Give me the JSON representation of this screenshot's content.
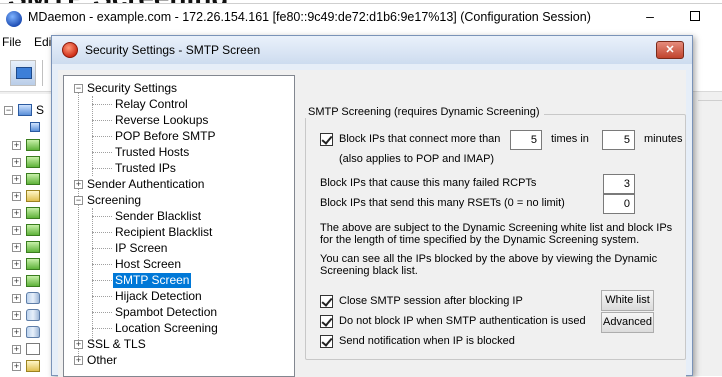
{
  "background_heading": "SMTP Screening",
  "main_window": {
    "title": "MDaemon - example.com - 172.26.154.161 [fe80::9c49:de72:d1b6:9e17%13] (Configuration Session)",
    "menu": [
      "File",
      "Edi"
    ],
    "minimize_glyph": "–",
    "tree_label": "S"
  },
  "dialog": {
    "title": "Security Settings - SMTP Screen",
    "close_glyph": "✕"
  },
  "tree": {
    "security_settings": "Security Settings",
    "relay_control": "Relay Control",
    "reverse_lookups": "Reverse Lookups",
    "pop_before_smtp": "POP Before SMTP",
    "trusted_hosts": "Trusted Hosts",
    "trusted_ips": "Trusted IPs",
    "sender_authentication": "Sender Authentication",
    "screening": "Screening",
    "sender_blacklist": "Sender Blacklist",
    "recipient_blacklist": "Recipient Blacklist",
    "ip_screen": "IP Screen",
    "host_screen": "Host Screen",
    "smtp_screen": "SMTP Screen",
    "hijack_detection": "Hijack Detection",
    "spambot_detection": "Spambot Detection",
    "location_screening": "Location Screening",
    "ssl_tls": "SSL & TLS",
    "other": "Other",
    "expand_glyph": "+",
    "collapse_glyph": "−"
  },
  "panel": {
    "group_title": "SMTP Screening (requires Dynamic Screening)",
    "block_connect_label": "Block IPs that connect more than",
    "block_connect_times": "5",
    "times_in_label": "times in",
    "block_connect_minutes": "5",
    "minutes_label": "minutes",
    "pop_imap_note": "(also applies to POP and IMAP)",
    "failed_rcpts_label": "Block IPs that cause this many failed RCPTs",
    "failed_rcpts_value": "3",
    "rsets_label": "Block IPs that send this many RSETs (0 = no limit)",
    "rsets_value": "0",
    "info1_line1": "The above are subject to the Dynamic Screening white list and block IPs",
    "info1_line2": "for the length of time specified by the Dynamic Screening system.",
    "info2_line1": "You can see all the IPs blocked by the above by viewing the Dynamic",
    "info2_line2": "Screening black list.",
    "close_session_label": "Close SMTP session after blocking IP",
    "no_block_auth_label": "Do not block IP when SMTP authentication is used",
    "send_notification_label": "Send notification when IP is blocked",
    "white_list_button": "White list",
    "advanced_button": "Advanced",
    "block_connect_checked": true,
    "close_session_checked": true,
    "no_block_auth_checked": true,
    "send_notification_checked": true
  }
}
